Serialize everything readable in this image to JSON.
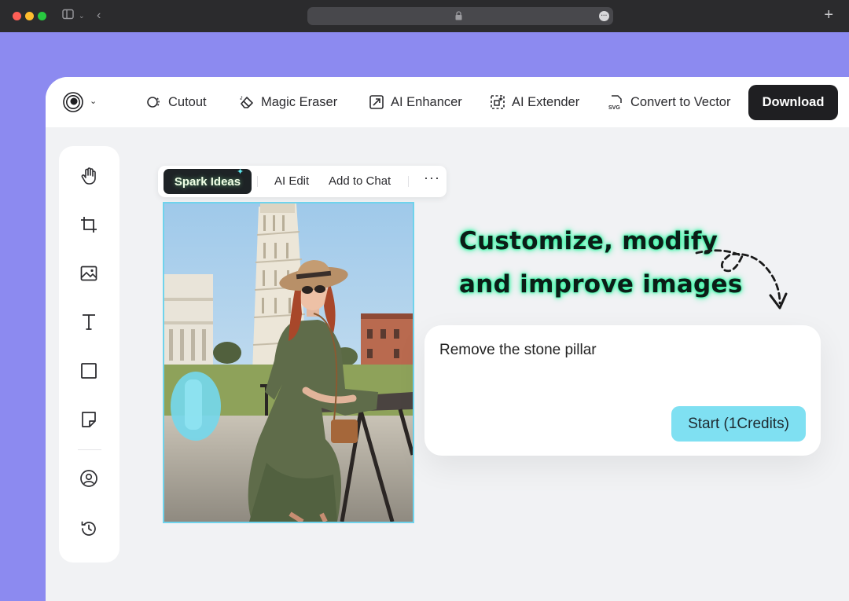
{
  "toolbar": {
    "cutout": "Cutout",
    "magic_eraser": "Magic Eraser",
    "ai_enhancer": "AI Enhancer",
    "ai_extender": "AI Extender",
    "convert_to_vector": "Convert to Vector",
    "download": "Download"
  },
  "float_toolbar": {
    "spark_ideas": "Spark Ideas",
    "ai_edit": "AI Edit",
    "add_to_chat": "Add to Chat",
    "more": "···"
  },
  "headline": {
    "line1": "Customize, modify",
    "line2": "and improve images"
  },
  "prompt": {
    "text": "Remove the stone pillar",
    "start_button": "Start (1Credits)"
  },
  "sidebar_icons": [
    "hand-icon",
    "crop-icon",
    "image-icon",
    "text-icon",
    "rectangle-icon",
    "sticky-note-icon",
    "profile-icon",
    "history-icon"
  ],
  "colors": {
    "background": "#8c8af0",
    "accent_cyan": "#7fe0f2",
    "headline_glow": "#2df5a0",
    "download_button": "#1f1f22"
  }
}
